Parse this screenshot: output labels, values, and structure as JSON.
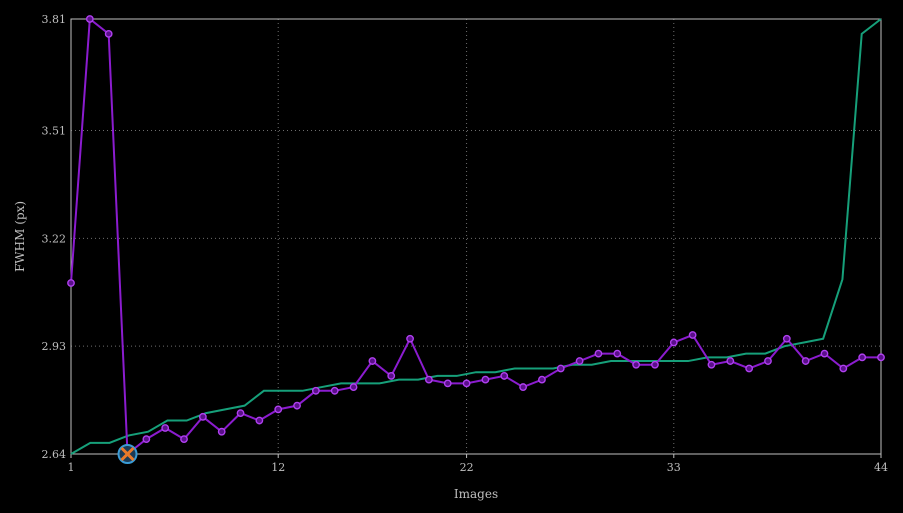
{
  "chart_data": {
    "type": "line",
    "xlabel": "Images",
    "ylabel": "FWHM (px)",
    "xlim": [
      1,
      44
    ],
    "ylim": [
      2.64,
      3.81
    ],
    "x_ticks": [
      "1",
      "12",
      "22",
      "33",
      "44"
    ],
    "y_ticks": [
      "2.64",
      "2.93",
      "3.22",
      "3.51",
      "3.81"
    ],
    "grid": true,
    "colors": {
      "background": "#000000",
      "grid": "#6e6e6e",
      "axis": "#bfbfbf",
      "series_raw": "#8b1ccf",
      "series_sorted": "#16a07a",
      "marker": "#e8792a",
      "marker_ring": "#3a9bd5"
    },
    "series": [
      {
        "key": "raw",
        "values": [
          3.1,
          3.81,
          3.77,
          2.64,
          2.68,
          2.71,
          2.68,
          2.74,
          2.7,
          2.75,
          2.73,
          2.76,
          2.77,
          2.81,
          2.81,
          2.82,
          2.89,
          2.85,
          2.95,
          2.84,
          2.83,
          2.83,
          2.84,
          2.85,
          2.82,
          2.84,
          2.87,
          2.89,
          2.91,
          2.91,
          2.88,
          2.88,
          2.94,
          2.96,
          2.88,
          2.89,
          2.87,
          2.89,
          2.95,
          2.89,
          2.91,
          2.87,
          2.9,
          2.9
        ]
      },
      {
        "key": "sorted",
        "values": [
          2.64,
          2.67,
          2.67,
          2.69,
          2.7,
          2.73,
          2.73,
          2.75,
          2.76,
          2.77,
          2.81,
          2.81,
          2.81,
          2.82,
          2.83,
          2.83,
          2.83,
          2.84,
          2.84,
          2.85,
          2.85,
          2.86,
          2.86,
          2.87,
          2.87,
          2.87,
          2.88,
          2.88,
          2.89,
          2.89,
          2.89,
          2.89,
          2.89,
          2.9,
          2.9,
          2.91,
          2.91,
          2.93,
          2.94,
          2.95,
          3.11,
          3.77,
          3.81
        ]
      }
    ],
    "highlight_index": 3
  }
}
